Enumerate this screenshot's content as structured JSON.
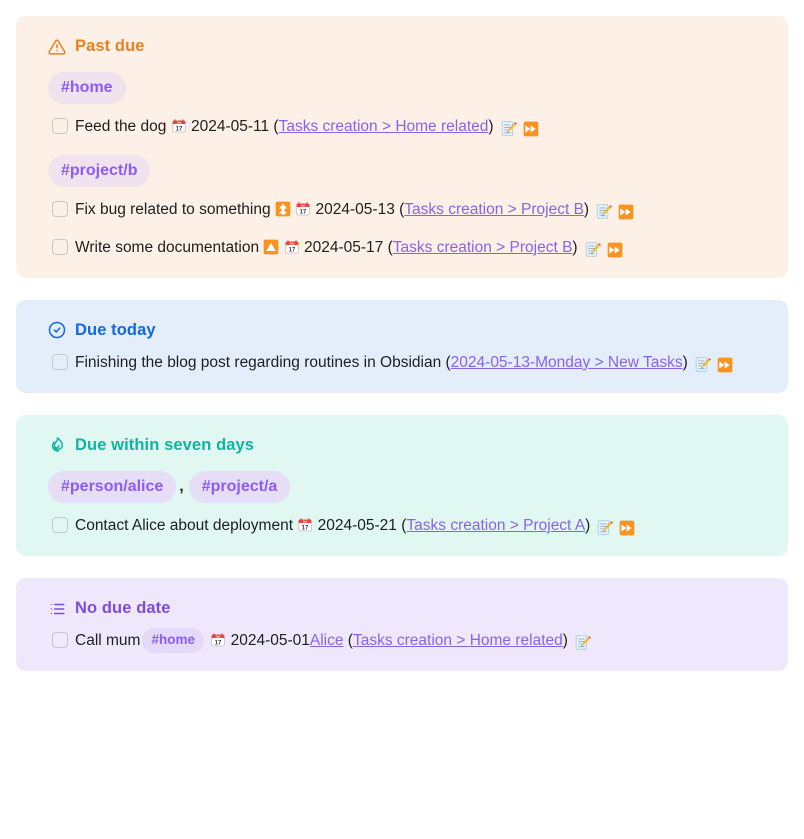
{
  "colors": {
    "past_due_bg": "#fdf0e6",
    "past_due_fg": "#eb8020",
    "due_today_bg": "#e4edfa",
    "due_today_fg": "#1268e0",
    "due_week_bg": "#e0f7f2",
    "due_week_fg": "#10b5a0",
    "no_due_bg": "#efe8fc",
    "no_due_fg": "#7c4ddd",
    "link": "#8a63e8",
    "tag_text": "#8b5cf6"
  },
  "sections": [
    {
      "id": "past-due",
      "title": "Past due",
      "icon": "warning-triangle-icon",
      "groups": [
        {
          "tags": [
            "#home"
          ],
          "tasks": [
            {
              "text": "Feed the dog",
              "priority": null,
              "date_icon": "calendar-icon",
              "date": "2024-05-11",
              "link": "Tasks creation > Home related",
              "actions": [
                "edit-icon",
                "postpone-icon"
              ]
            }
          ]
        },
        {
          "tags": [
            "#project/b"
          ],
          "tasks": [
            {
              "text": "Fix bug related to something",
              "priority": "priority-high-icon",
              "date_icon": "calendar-icon",
              "date": "2024-05-13",
              "link": "Tasks creation > Project B",
              "actions": [
                "edit-icon",
                "postpone-icon"
              ]
            },
            {
              "text": "Write some documentation",
              "priority": "priority-medium-icon",
              "date_icon": "calendar-icon",
              "date": "2024-05-17",
              "link": "Tasks creation > Project B",
              "actions": [
                "edit-icon",
                "postpone-icon"
              ]
            }
          ]
        }
      ]
    },
    {
      "id": "due-today",
      "title": "Due today",
      "icon": "check-circle-icon",
      "groups": [
        {
          "tags": [],
          "tasks": [
            {
              "text": "Finishing the blog post regarding routines in Obsidian",
              "priority": null,
              "date_icon": null,
              "date": null,
              "link": "2024-05-13-Monday > New Tasks",
              "actions": [
                "edit-icon",
                "postpone-icon"
              ]
            }
          ]
        }
      ]
    },
    {
      "id": "due-week",
      "title": "Due within seven days",
      "icon": "flame-icon",
      "groups": [
        {
          "tags": [
            "#person/alice",
            "#project/a"
          ],
          "tasks": [
            {
              "text": "Contact Alice about deployment",
              "priority": null,
              "date_icon": "calendar-icon",
              "date": "2024-05-21",
              "link": "Tasks creation > Project A",
              "actions": [
                "edit-icon",
                "postpone-icon"
              ]
            }
          ]
        }
      ]
    },
    {
      "id": "no-due",
      "title": "No due date",
      "icon": "list-icon",
      "groups": [
        {
          "tags": [],
          "tasks": [
            {
              "text": "Call mum",
              "inline_tag": "#home",
              "priority": null,
              "date_icon": "calendar-icon",
              "date": "2024-05-01",
              "pre_link": "Alice",
              "link": "Tasks creation > Home related",
              "actions": [
                "edit-icon"
              ]
            }
          ]
        }
      ]
    }
  ],
  "tag_separator": ","
}
